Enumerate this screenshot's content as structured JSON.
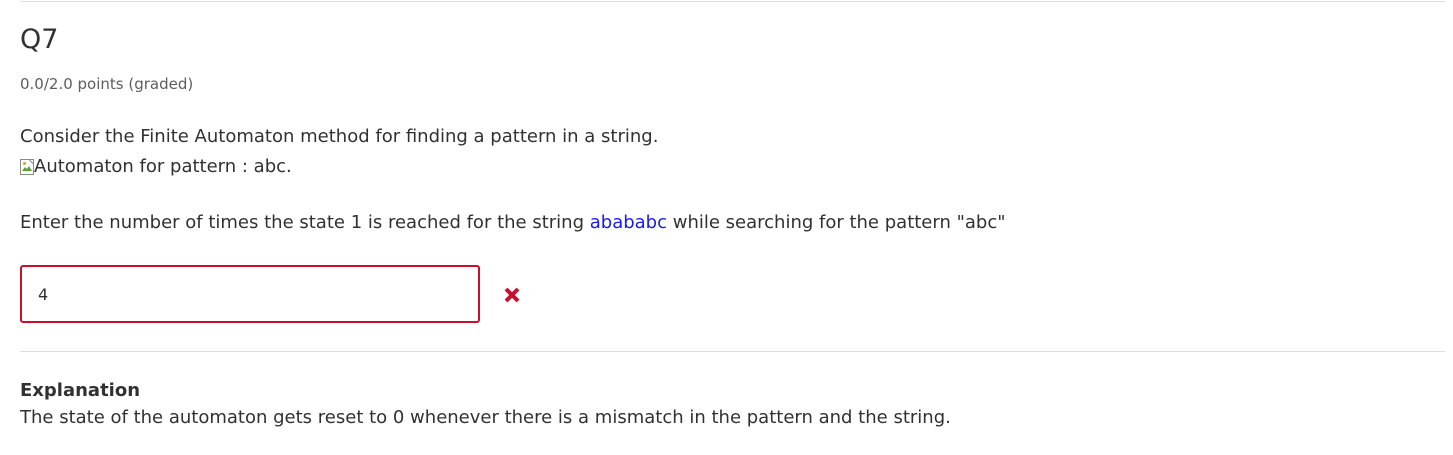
{
  "question": {
    "title": "Q7",
    "points": "0.0/2.0 points (graded)",
    "prompt": "Consider the Finite Automaton method for finding a pattern in a string.",
    "image_alt": "Automaton for pattern : abc.",
    "text_before": "Enter the number of times the state 1 is reached for the string ",
    "highlight": "abababc",
    "text_after": " while searching for the pattern \"abc\""
  },
  "answer": {
    "value": "4",
    "status": "incorrect",
    "status_icon": "cross-icon",
    "status_color": "#c8102e"
  },
  "explanation": {
    "title": "Explanation",
    "text": "The state of the automaton gets reset to 0 whenever there is a mismatch in the pattern and the string."
  },
  "colors": {
    "text": "#313131",
    "muted": "#5e5e5e",
    "link": "#1a1aee",
    "error": "#c8102e",
    "rule": "#dddddd"
  }
}
